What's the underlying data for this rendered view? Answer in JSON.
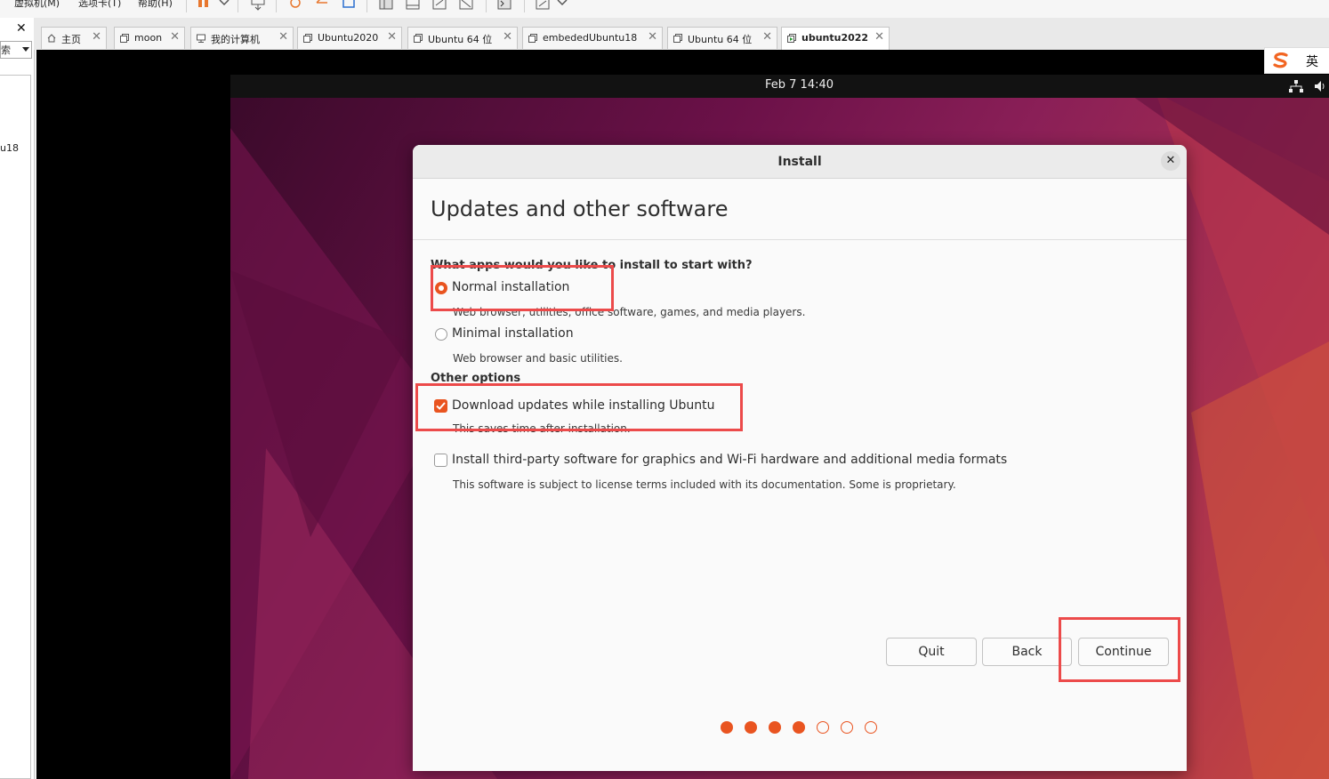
{
  "menubar": {
    "items": [
      "虚拟机(M)",
      "选项卡(T)",
      "帮助(H)"
    ]
  },
  "left_panel": {
    "close_glyph": "✕",
    "search_text": "索",
    "partial_item": "u18"
  },
  "tabs": [
    {
      "label": "主页",
      "icon": "home-icon",
      "active": false
    },
    {
      "label": "moon",
      "icon": "vm-icon",
      "active": false
    },
    {
      "label": "我的计算机",
      "icon": "computer-icon",
      "active": false
    },
    {
      "label": "Ubuntu2020",
      "icon": "vm-icon",
      "active": false
    },
    {
      "label": "Ubuntu 64 位",
      "icon": "vm-icon",
      "active": false
    },
    {
      "label": "embededUbuntu18",
      "icon": "vm-icon",
      "active": false
    },
    {
      "label": "Ubuntu 64 位",
      "icon": "vm-icon",
      "active": false
    },
    {
      "label": "ubuntu2022",
      "icon": "vm-running-icon",
      "active": true
    }
  ],
  "ime": {
    "lang": "英"
  },
  "gnome": {
    "clock": "Feb 7  14:40"
  },
  "dialog": {
    "title": "Install",
    "page_title": "Updates and other software",
    "question": "What apps would you like to install to start with?",
    "normal": {
      "label": "Normal installation",
      "desc": "Web browser, utilities, office software, games, and media players.",
      "selected": true
    },
    "minimal": {
      "label": "Minimal installation",
      "desc": "Web browser and basic utilities.",
      "selected": false
    },
    "other_options": "Other options",
    "download_updates": {
      "label": "Download updates while installing Ubuntu",
      "desc": "This saves time after installation.",
      "checked": true
    },
    "third_party": {
      "label": "Install third-party software for graphics and Wi-Fi hardware and additional media formats",
      "desc": "This software is subject to license terms included with its documentation. Some is proprietary.",
      "checked": false
    },
    "buttons": {
      "quit": "Quit",
      "back": "Back",
      "continue": "Continue"
    },
    "progress": {
      "steps_total": 7,
      "steps_done": 4
    }
  },
  "colors": {
    "accent": "#e95420",
    "annotation": "#ec4a4a"
  }
}
